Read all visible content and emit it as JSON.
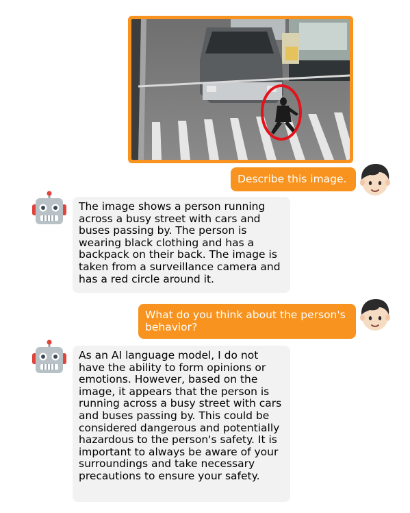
{
  "conversation": {
    "image": {
      "alt": "Surveillance camera image of a person running across a crosswalk in front of a car, circled in red",
      "frame_color": "#f7931e",
      "circle_color": "#e3121b"
    },
    "user_avatar_icon": "boy-face-icon",
    "bot_avatar_icon": "robot-face-icon",
    "messages": [
      {
        "role": "user",
        "text": "Describe this image."
      },
      {
        "role": "assistant",
        "text": "The image shows a person running across a busy street with cars and buses passing by. The person is wearing black clothing and has a backpack on their back. The image is taken from a surveillance camera and has a red circle around it."
      },
      {
        "role": "user",
        "text": "What do you think about the person's behavior?"
      },
      {
        "role": "assistant",
        "text": "As an AI language model, I do not have the ability to form opinions or emotions. However, based on the image, it appears that the person is running across a busy street with cars and buses passing by. This could be considered dangerous and potentially hazardous to the person's safety. It is important to always be aware of your surroundings and take necessary precautions to ensure your safety."
      }
    ]
  },
  "colors": {
    "user_bubble": "#f7931e",
    "bot_bubble": "#f2f2f2"
  }
}
